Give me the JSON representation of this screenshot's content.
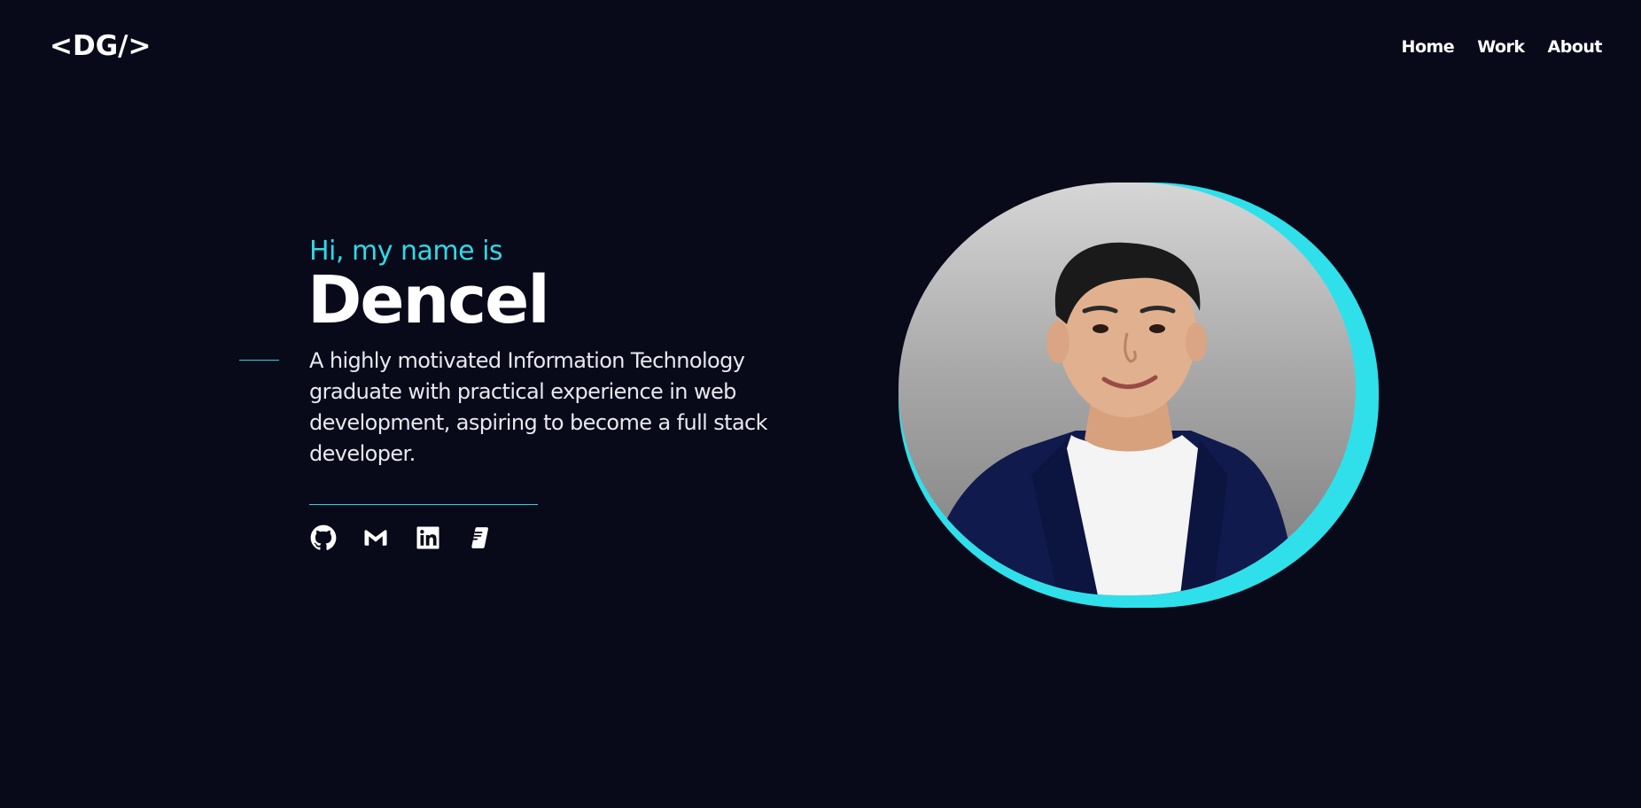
{
  "header": {
    "logo": "<DG/>",
    "nav": [
      {
        "label": "Home"
      },
      {
        "label": "Work"
      },
      {
        "label": "About"
      }
    ]
  },
  "hero": {
    "greeting": "Hi, my name is",
    "name": "Dencel",
    "bio": "A highly motivated Information Technology graduate with practical experience in web development, aspiring to become a full stack developer.",
    "socials": [
      {
        "icon": "github-icon"
      },
      {
        "icon": "gmail-icon"
      },
      {
        "icon": "linkedin-icon"
      },
      {
        "icon": "resume-icon"
      }
    ]
  },
  "colors": {
    "background": "#080a1a",
    "accent": "#31d8e6",
    "text": "#ffffff"
  }
}
